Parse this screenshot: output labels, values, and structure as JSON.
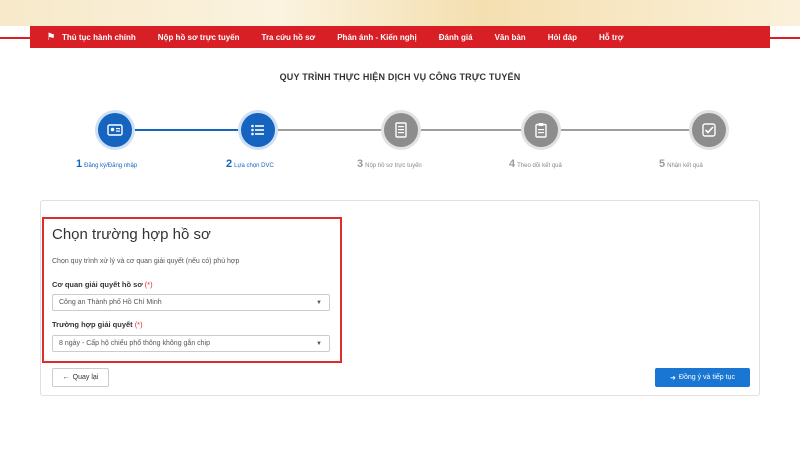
{
  "nav": {
    "home_icon": "home-icon",
    "items": [
      {
        "label": "Thủ tục hành chính"
      },
      {
        "label": "Nộp hồ sơ trực tuyến"
      },
      {
        "label": "Tra cứu hồ sơ"
      },
      {
        "label": "Phản ánh - Kiến nghị"
      },
      {
        "label": "Đánh giá"
      },
      {
        "label": "Văn bản"
      },
      {
        "label": "Hỏi đáp"
      },
      {
        "label": "Hỗ trợ"
      }
    ]
  },
  "page_title": "QUY TRÌNH THỰC HIỆN DỊCH VỤ CÔNG TRỰC TUYẾN",
  "steps": [
    {
      "number": "1",
      "label": "Đăng ký/Đăng nhập",
      "icon": "id-card-icon",
      "state": "active"
    },
    {
      "number": "2",
      "label": "Lựa chọn DVC",
      "icon": "list-icon",
      "state": "active"
    },
    {
      "number": "3",
      "label": "Nộp hồ sơ trực tuyến",
      "icon": "document-icon",
      "state": "inactive"
    },
    {
      "number": "4",
      "label": "Theo dõi kết quả",
      "icon": "clipboard-icon",
      "state": "inactive"
    },
    {
      "number": "5",
      "label": "Nhận kết quả",
      "icon": "check-icon",
      "state": "inactive"
    }
  ],
  "form": {
    "title": "Chọn trường hợp hồ sơ",
    "description": "Chọn quy trình xử lý và cơ quan giải quyết (nếu có) phù hợp",
    "agency_label": "Cơ quan giải quyết hồ sơ",
    "agency_required": "(*)",
    "agency_value": "Công an Thành phố Hồ Chí Minh",
    "case_label": "Trường hợp giải quyết",
    "case_required": "(*)",
    "case_value": "8 ngày - Cấp hộ chiếu phổ thông không gắn chip"
  },
  "buttons": {
    "back_label": "Quay lại",
    "next_label": "Đồng ý và tiếp tục"
  },
  "colors": {
    "brand_red": "#d81f26",
    "active_blue": "#1565c0",
    "inactive_gray": "#8d8d8d",
    "button_blue": "#1976d2"
  }
}
